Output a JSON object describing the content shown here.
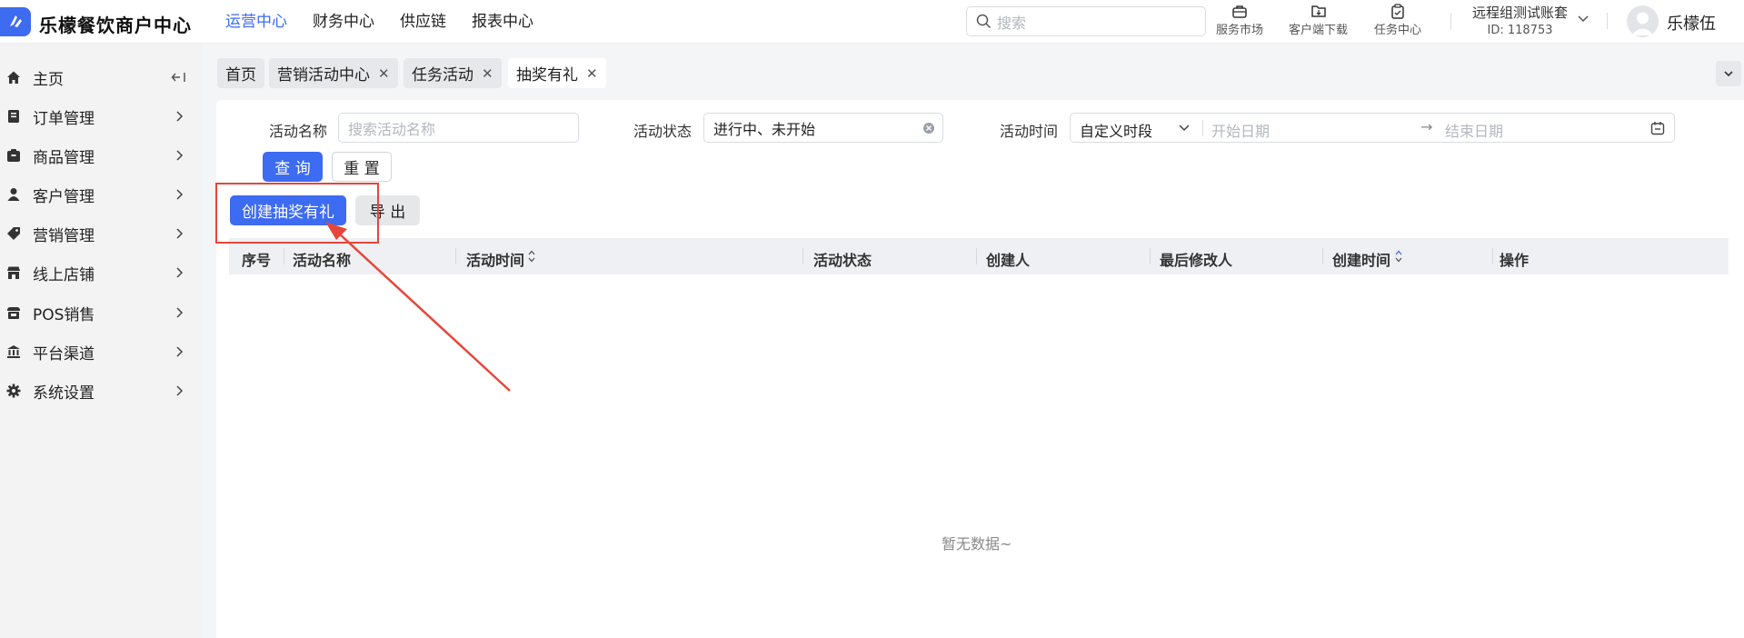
{
  "brand": {
    "name": "乐檬餐饮商户中心",
    "color": "#3d6bf1"
  },
  "top_nav": [
    {
      "label": "运营中心",
      "active": true
    },
    {
      "label": "财务中心",
      "active": false
    },
    {
      "label": "供应链",
      "active": false
    },
    {
      "label": "报表中心",
      "active": false
    }
  ],
  "search": {
    "placeholder": "搜索",
    "icon": "search-icon"
  },
  "tools": [
    {
      "label": "服务市场",
      "icon": "briefcase-icon"
    },
    {
      "label": "客户端下载",
      "icon": "folder-download-icon"
    },
    {
      "label": "任务中心",
      "icon": "clipboard-check-icon"
    }
  ],
  "account": {
    "name": "远程组测试账套",
    "id": "ID: 118753"
  },
  "user": {
    "name": "乐檬伍"
  },
  "sidebar": {
    "items": [
      {
        "label": "主页",
        "icon": "home-icon"
      },
      {
        "label": "订单管理",
        "icon": "order-icon"
      },
      {
        "label": "商品管理",
        "icon": "box-icon"
      },
      {
        "label": "客户管理",
        "icon": "user-icon"
      },
      {
        "label": "营销管理",
        "icon": "tag-icon"
      },
      {
        "label": "线上店铺",
        "icon": "shop-icon"
      },
      {
        "label": "POS销售",
        "icon": "store-icon"
      },
      {
        "label": "平台渠道",
        "icon": "bank-icon"
      },
      {
        "label": "系统设置",
        "icon": "gear-icon"
      }
    ]
  },
  "tabs": [
    {
      "label": "首页",
      "closable": false,
      "active": false
    },
    {
      "label": "营销活动中心",
      "closable": true,
      "active": false
    },
    {
      "label": "任务活动",
      "closable": true,
      "active": false
    },
    {
      "label": "抽奖有礼",
      "closable": true,
      "active": true
    }
  ],
  "filters": {
    "name_label": "活动名称",
    "name_placeholder": "搜索活动名称",
    "status_label": "活动状态",
    "status_value": "进行中、未开始",
    "time_label": "活动时间",
    "time_mode": "自定义时段",
    "start_placeholder": "开始日期",
    "end_placeholder": "结束日期",
    "range_sep": "→"
  },
  "buttons": {
    "query": "查 询",
    "reset": "重 置",
    "create": "创建抽奖有礼",
    "export": "导 出"
  },
  "table": {
    "columns": [
      "序号",
      "活动名称",
      "活动时间",
      "活动状态",
      "创建人",
      "最后修改人",
      "创建时间",
      "操作"
    ],
    "empty_text": "暂无数据~"
  },
  "annotation_color": "#e5473a"
}
